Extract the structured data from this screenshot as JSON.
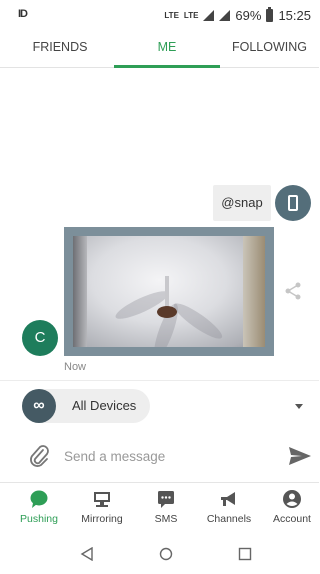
{
  "status_bar": {
    "left_icon": "ID",
    "network_1": "LTE",
    "network_2": "LTE",
    "battery": "69%",
    "time": "15:25"
  },
  "tabs": [
    {
      "label": "FRIENDS",
      "active": false
    },
    {
      "label": "ME",
      "active": true
    },
    {
      "label": "FOLLOWING",
      "active": false
    }
  ],
  "chat": {
    "sent_message": "@snap",
    "sender_initial": "C",
    "timestamp": "Now",
    "image_description_icon": "ceiling-fan-photo"
  },
  "device_selector": {
    "icon": "infinity-icon",
    "label": "All Devices"
  },
  "composer": {
    "placeholder": "Send a message",
    "value": ""
  },
  "bottom_nav": [
    {
      "label": "Pushing",
      "icon": "chat-bubble-icon",
      "active": true
    },
    {
      "label": "Mirroring",
      "icon": "computer-icon",
      "active": false
    },
    {
      "label": "SMS",
      "icon": "sms-icon",
      "active": false
    },
    {
      "label": "Channels",
      "icon": "megaphone-icon",
      "active": false
    },
    {
      "label": "Account",
      "icon": "account-icon",
      "active": false
    }
  ],
  "colors": {
    "accent": "#2e9e56",
    "avatar_dark": "#546e7a",
    "sender_avatar": "#1e7d5c"
  }
}
